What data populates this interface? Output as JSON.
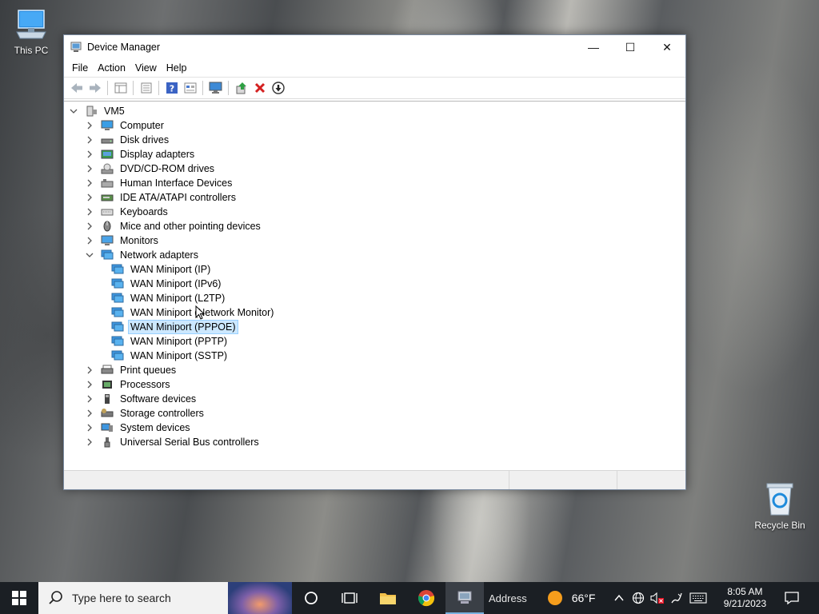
{
  "desktop": {
    "icons": [
      {
        "label": "This PC"
      },
      {
        "label": "Recycle Bin"
      }
    ]
  },
  "window": {
    "title": "Device Manager",
    "controls": {
      "minimize": "—",
      "maximize": "☐",
      "close": "✕"
    },
    "menu": [
      "File",
      "Action",
      "View",
      "Help"
    ],
    "toolbar": [
      "back-arrow-icon",
      "forward-arrow-icon",
      "properties-sheet-icon",
      "show-hidden-icon",
      "help-icon",
      "resource-view-icon",
      "monitor-scan-icon",
      "update-driver-icon",
      "uninstall-icon",
      "download-icon"
    ],
    "tree": {
      "root": "VM5",
      "categories": [
        {
          "label": "Computer",
          "expanded": false
        },
        {
          "label": "Disk drives",
          "expanded": false
        },
        {
          "label": "Display adapters",
          "expanded": false
        },
        {
          "label": "DVD/CD-ROM drives",
          "expanded": false
        },
        {
          "label": "Human Interface Devices",
          "expanded": false
        },
        {
          "label": "IDE ATA/ATAPI controllers",
          "expanded": false
        },
        {
          "label": "Keyboards",
          "expanded": false
        },
        {
          "label": "Mice and other pointing devices",
          "expanded": false
        },
        {
          "label": "Monitors",
          "expanded": false
        },
        {
          "label": "Network adapters",
          "expanded": true,
          "children": [
            "WAN Miniport (IP)",
            "WAN Miniport (IPv6)",
            "WAN Miniport (L2TP)",
            "WAN Miniport (Network Monitor)",
            "WAN Miniport (PPPOE)",
            "WAN Miniport (PPTP)",
            "WAN Miniport (SSTP)"
          ],
          "selected_child": "WAN Miniport (PPPOE)"
        },
        {
          "label": "Print queues",
          "expanded": false
        },
        {
          "label": "Processors",
          "expanded": false
        },
        {
          "label": "Software devices",
          "expanded": false
        },
        {
          "label": "Storage controllers",
          "expanded": false
        },
        {
          "label": "System devices",
          "expanded": false
        },
        {
          "label": "Universal Serial Bus controllers",
          "expanded": false
        }
      ]
    }
  },
  "taskbar": {
    "search_placeholder": "Type here to search",
    "address_label": "Address",
    "weather": {
      "temp": "66°F"
    },
    "clock": {
      "time": "8:05 AM",
      "date": "9/21/2023"
    }
  },
  "colors": {
    "selection_bg": "#cce8ff",
    "taskbar_bg": "#1b1f24",
    "accent": "#0078d7"
  }
}
